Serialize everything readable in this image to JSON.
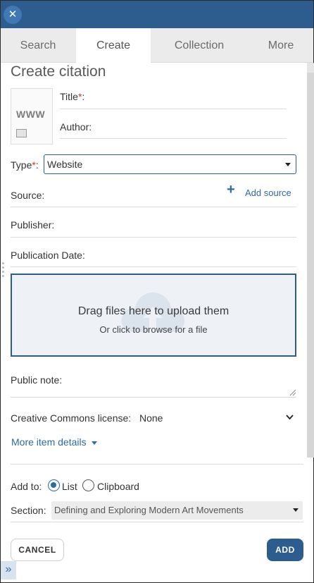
{
  "header": {
    "close_icon": "close-icon"
  },
  "tabs": [
    {
      "label": "Search",
      "active": false
    },
    {
      "label": "Create",
      "active": true
    },
    {
      "label": "Collection",
      "active": false
    },
    {
      "label": "More",
      "active": false
    }
  ],
  "form": {
    "heading": "Create citation",
    "thumbnail_text": "WWW",
    "title_label": "Title",
    "author_label": "Author:",
    "type_label": "Type",
    "type_value": "Website",
    "source_label": "Source:",
    "add_source_label": "Add source",
    "publisher_label": "Publisher:",
    "publication_date_label": "Publication Date:",
    "dropzone_title": "Drag files here to upload them",
    "dropzone_subtitle": "Or click to browse for a file",
    "public_note_label": "Public note:",
    "cc_license_label": "Creative Commons license:",
    "cc_license_value": "None",
    "more_details_label": "More item details",
    "add_to_label": "Add to:",
    "add_to_options": [
      {
        "label": "List",
        "checked": true
      },
      {
        "label": "Clipboard",
        "checked": false
      }
    ],
    "section_label": "Section:",
    "section_value": "Defining and Exploring Modern Art Movements",
    "required_marker": "*",
    "colon": ":",
    "cancel_label": "CANCEL",
    "add_label": "ADD"
  },
  "colors": {
    "primary": "#2d5c8e",
    "link": "#2d6aa8",
    "required": "#c0392b"
  }
}
